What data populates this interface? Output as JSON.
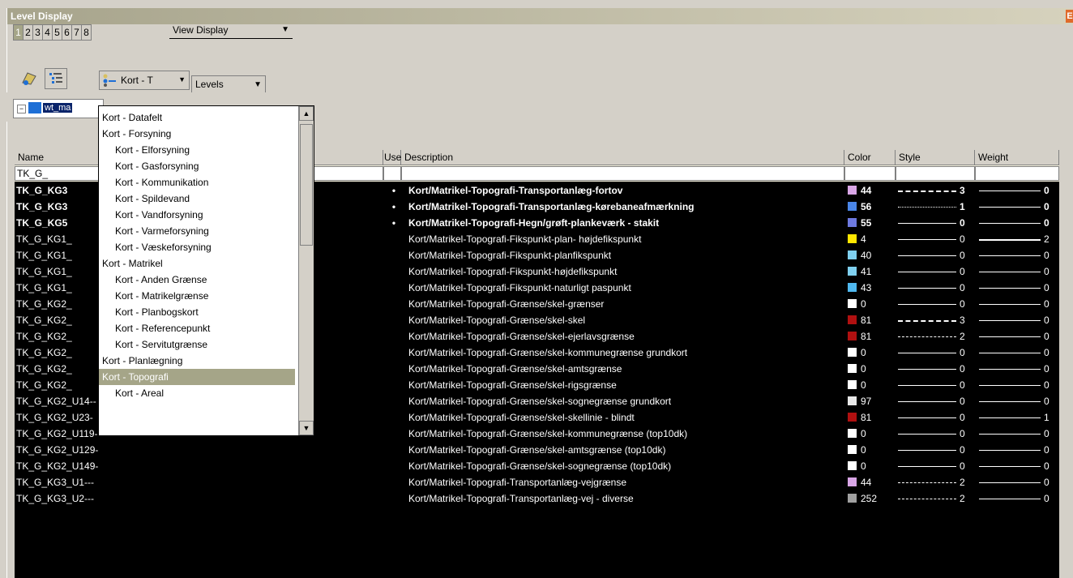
{
  "window": {
    "title": "Level Display",
    "close_label": "E"
  },
  "number_tabs": [
    "1",
    "2",
    "3",
    "4",
    "5",
    "6",
    "7",
    "8"
  ],
  "view_display": {
    "label": "View Display"
  },
  "toolbar": {
    "kort_label": "Kort - T",
    "levels_label": "Levels"
  },
  "file": {
    "label": "wt_ma"
  },
  "columns": {
    "name": "Name",
    "use": "Use",
    "description": "Description",
    "color": "Color",
    "style": "Style",
    "weight": "Weight"
  },
  "filter": {
    "name_value": "TK_G_"
  },
  "rows": [
    {
      "name": "TK_G_KG3",
      "use": "•",
      "desc": "Kort/Matrikel-Topografi-Transportanlæg-fortov",
      "color": "#d9a6e6",
      "color_num": "44",
      "style_type": "long",
      "style_num": "3",
      "weight": "0",
      "bold": true
    },
    {
      "name": "TK_G_KG3",
      "use": "•",
      "desc": "Kort/Matrikel-Topografi-Transportanlæg-kørebaneafmærkning",
      "color": "#4a86e8",
      "color_num": "56",
      "style_type": "dot",
      "style_num": "1",
      "weight": "0",
      "bold": true
    },
    {
      "name": "TK_G_KG5",
      "use": "•",
      "desc": "Kort/Matrikel-Topografi-Hegn/grøft-plankeværk - stakit",
      "color": "#6e7ae0",
      "color_num": "55",
      "style_type": "solid",
      "style_num": "0",
      "weight": "0",
      "bold": true
    },
    {
      "name": "TK_G_KG1_",
      "use": "",
      "desc": "Kort/Matrikel-Topografi-Fikspunkt-plan- højdefikspunkt",
      "color": "#ffe600",
      "color_num": "4",
      "style_type": "solid",
      "style_num": "0",
      "weight": "2",
      "bold": false
    },
    {
      "name": "TK_G_KG1_",
      "use": "",
      "desc": "Kort/Matrikel-Topografi-Fikspunkt-planfikspunkt",
      "color": "#7fd0f0",
      "color_num": "40",
      "style_type": "solid",
      "style_num": "0",
      "weight": "0",
      "bold": false
    },
    {
      "name": "TK_G_KG1_",
      "use": "",
      "desc": "Kort/Matrikel-Topografi-Fikspunkt-højdefikspunkt",
      "color": "#7fd0f0",
      "color_num": "41",
      "style_type": "solid",
      "style_num": "0",
      "weight": "0",
      "bold": false
    },
    {
      "name": "TK_G_KG1_",
      "use": "",
      "desc": "Kort/Matrikel-Topografi-Fikspunkt-naturligt paspunkt",
      "color": "#4fb8ef",
      "color_num": "43",
      "style_type": "solid",
      "style_num": "0",
      "weight": "0",
      "bold": false
    },
    {
      "name": "TK_G_KG2_",
      "use": "",
      "desc": "Kort/Matrikel-Topografi-Grænse/skel-grænser",
      "color": "#ffffff",
      "color_num": "0",
      "style_type": "solid",
      "style_num": "0",
      "weight": "0",
      "bold": false
    },
    {
      "name": "TK_G_KG2_",
      "use": "",
      "desc": "Kort/Matrikel-Topografi-Grænse/skel-skel",
      "color": "#b01010",
      "color_num": "81",
      "style_type": "long",
      "style_num": "3",
      "weight": "0",
      "bold": false
    },
    {
      "name": "TK_G_KG2_",
      "use": "",
      "desc": "Kort/Matrikel-Topografi-Grænse/skel-ejerlavsgrænse",
      "color": "#b01010",
      "color_num": "81",
      "style_type": "dash",
      "style_num": "2",
      "weight": "0",
      "bold": false
    },
    {
      "name": "TK_G_KG2_",
      "use": "",
      "desc": "Kort/Matrikel-Topografi-Grænse/skel-kommunegrænse grundkort",
      "color": "#ffffff",
      "color_num": "0",
      "style_type": "solid",
      "style_num": "0",
      "weight": "0",
      "bold": false
    },
    {
      "name": "TK_G_KG2_",
      "use": "",
      "desc": "Kort/Matrikel-Topografi-Grænse/skel-amtsgrænse",
      "color": "#ffffff",
      "color_num": "0",
      "style_type": "solid",
      "style_num": "0",
      "weight": "0",
      "bold": false
    },
    {
      "name": "TK_G_KG2_",
      "use": "",
      "desc": "Kort/Matrikel-Topografi-Grænse/skel-rigsgrænse",
      "color": "#ffffff",
      "color_num": "0",
      "style_type": "solid",
      "style_num": "0",
      "weight": "0",
      "bold": false
    },
    {
      "name": "TK_G_KG2_U14--",
      "use": "",
      "desc": "Kort/Matrikel-Topografi-Grænse/skel-sognegrænse grundkort",
      "color": "#e8e8e8",
      "color_num": "97",
      "style_type": "solid",
      "style_num": "0",
      "weight": "0",
      "bold": false
    },
    {
      "name": "TK_G_KG2_U23-",
      "use": "",
      "desc": "Kort/Matrikel-Topografi-Grænse/skel-skellinie - blindt",
      "color": "#b01010",
      "color_num": "81",
      "style_type": "solid",
      "style_num": "0",
      "weight": "1",
      "bold": false
    },
    {
      "name": "TK_G_KG2_U119-",
      "use": "",
      "desc": "Kort/Matrikel-Topografi-Grænse/skel-kommunegrænse (top10dk)",
      "color": "#ffffff",
      "color_num": "0",
      "style_type": "solid",
      "style_num": "0",
      "weight": "0",
      "bold": false
    },
    {
      "name": "TK_G_KG2_U129-",
      "use": "",
      "desc": "Kort/Matrikel-Topografi-Grænse/skel-amtsgrænse (top10dk)",
      "color": "#ffffff",
      "color_num": "0",
      "style_type": "solid",
      "style_num": "0",
      "weight": "0",
      "bold": false
    },
    {
      "name": "TK_G_KG2_U149-",
      "use": "",
      "desc": "Kort/Matrikel-Topografi-Grænse/skel-sognegrænse (top10dk)",
      "color": "#ffffff",
      "color_num": "0",
      "style_type": "solid",
      "style_num": "0",
      "weight": "0",
      "bold": false
    },
    {
      "name": "TK_G_KG3_U1---",
      "use": "",
      "desc": "Kort/Matrikel-Topografi-Transportanlæg-vejgrænse",
      "color": "#d9a6e6",
      "color_num": "44",
      "style_type": "dash",
      "style_num": "2",
      "weight": "0",
      "bold": false
    },
    {
      "name": "TK_G_KG3_U2---",
      "use": "",
      "desc": "Kort/Matrikel-Topografi-Transportanlæg-vej - diverse",
      "color": "#a0a0a0",
      "color_num": "252",
      "style_type": "dash",
      "style_num": "2",
      "weight": "0",
      "bold": false
    }
  ],
  "popup": {
    "items": [
      {
        "label": "Kort - Datafelt",
        "indent": 0,
        "selected": false
      },
      {
        "label": "Kort - Forsyning",
        "indent": 0,
        "selected": false
      },
      {
        "label": "Kort - Elforsyning",
        "indent": 1,
        "selected": false
      },
      {
        "label": "Kort - Gasforsyning",
        "indent": 1,
        "selected": false
      },
      {
        "label": "Kort - Kommunikation",
        "indent": 1,
        "selected": false
      },
      {
        "label": "Kort - Spildevand",
        "indent": 1,
        "selected": false
      },
      {
        "label": "Kort - Vandforsyning",
        "indent": 1,
        "selected": false
      },
      {
        "label": "Kort - Varmeforsyning",
        "indent": 1,
        "selected": false
      },
      {
        "label": "Kort - Væskeforsyning",
        "indent": 1,
        "selected": false
      },
      {
        "label": "Kort - Matrikel",
        "indent": 0,
        "selected": false
      },
      {
        "label": "Kort - Anden Grænse",
        "indent": 1,
        "selected": false
      },
      {
        "label": "Kort - Matrikelgrænse",
        "indent": 1,
        "selected": false
      },
      {
        "label": "Kort - Planbogskort",
        "indent": 1,
        "selected": false
      },
      {
        "label": "Kort - Referencepunkt",
        "indent": 1,
        "selected": false
      },
      {
        "label": "Kort - Servitutgrænse",
        "indent": 1,
        "selected": false
      },
      {
        "label": "Kort - Planlægning",
        "indent": 0,
        "selected": false
      },
      {
        "label": "Kort - Topografi",
        "indent": 0,
        "selected": true
      },
      {
        "label": "Kort - Areal",
        "indent": 1,
        "selected": false
      }
    ]
  }
}
